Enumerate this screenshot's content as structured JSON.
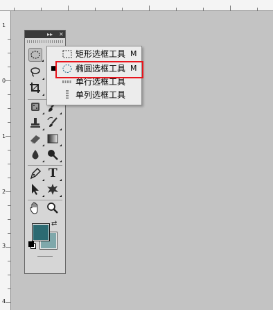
{
  "rulers": {
    "left_numbers": [
      "1",
      "0",
      "1",
      "2",
      "3",
      "4"
    ]
  },
  "toolbox": {
    "title_buttons": [
      "▸▸",
      "✕"
    ],
    "tools": [
      {
        "name": "rectangular-marquee-tool-button",
        "icon": "marquee-ellipse-icon",
        "active": true
      },
      {
        "name": "lasso-tool-button",
        "icon": "lasso-icon"
      },
      {
        "name": "magic-wand-tool-button",
        "icon": "magic-wand-icon"
      },
      {
        "name": "crop-tool-button",
        "icon": "crop-icon"
      },
      {
        "name": "slice-tool-button",
        "icon": "slice-icon"
      },
      {
        "name": "healing-brush-tool-button",
        "icon": "patch-icon"
      },
      {
        "name": "brush-tool-button",
        "icon": "brush-icon"
      },
      {
        "name": "clone-stamp-tool-button",
        "icon": "stamp-icon"
      },
      {
        "name": "history-brush-tool-button",
        "icon": "history-brush-icon"
      },
      {
        "name": "eraser-tool-button",
        "icon": "eraser-icon"
      },
      {
        "name": "gradient-tool-button",
        "icon": "gradient-icon"
      },
      {
        "name": "blur-tool-button",
        "icon": "drop-icon"
      },
      {
        "name": "dodge-tool-button",
        "icon": "dodge-icon"
      },
      {
        "name": "pen-tool-button",
        "icon": "pen-icon"
      },
      {
        "name": "type-tool-button",
        "icon": "type-icon"
      },
      {
        "name": "path-selection-tool-button",
        "icon": "arrow-icon"
      },
      {
        "name": "custom-shape-tool-button",
        "icon": "shape-icon"
      },
      {
        "name": "hand-tool-button",
        "icon": "hand-icon"
      },
      {
        "name": "zoom-tool-button",
        "icon": "zoom-icon"
      }
    ],
    "type_label": "T",
    "colors": {
      "foreground": "#2c6a72",
      "background": "#7fa8ab"
    }
  },
  "flyout_menu": {
    "items": [
      {
        "label": "矩形选框工具",
        "shortcut": "M",
        "icon": "rect-marquee-icon",
        "selected": false
      },
      {
        "label": "椭圆选框工具",
        "shortcut": "M",
        "icon": "elliptical-marquee-icon",
        "selected": true
      },
      {
        "label": "单行选框工具",
        "shortcut": "",
        "icon": "single-row-marquee-icon",
        "selected": false
      },
      {
        "label": "单列选框工具",
        "shortcut": "",
        "icon": "single-column-marquee-icon",
        "selected": false
      }
    ],
    "bullet": "■"
  },
  "annotation": {
    "color": "#e8141c"
  }
}
